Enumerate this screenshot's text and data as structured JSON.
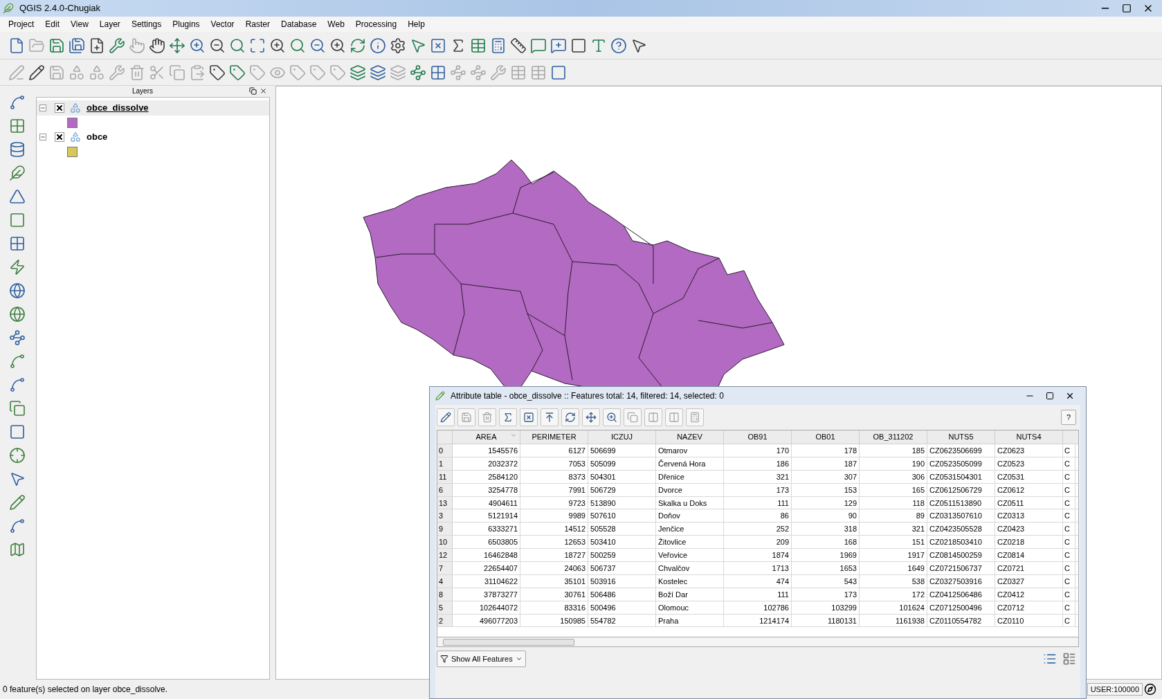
{
  "window": {
    "title": "QGIS 2.4.0-Chugiak"
  },
  "menu": [
    "Project",
    "Edit",
    "View",
    "Layer",
    "Settings",
    "Plugins",
    "Vector",
    "Raster",
    "Database",
    "Web",
    "Processing",
    "Help"
  ],
  "layers_panel": {
    "title": "Layers",
    "layers": [
      {
        "name": "obce_dissolve",
        "visible": true,
        "expanded": true,
        "selected": true,
        "color": "#b36ac2"
      },
      {
        "name": "obce",
        "visible": true,
        "expanded": true,
        "selected": false,
        "color": "#d8c85c"
      }
    ]
  },
  "attribute_table": {
    "title": "Attribute table - obce_dissolve :: Features total: 14, filtered: 14, selected: 0",
    "help": "?",
    "columns": [
      {
        "label": "AREA",
        "kind": "number",
        "sorted": true
      },
      {
        "label": "PERIMETER",
        "kind": "number",
        "sorted": false
      },
      {
        "label": "ICZUJ",
        "kind": "text",
        "sorted": false
      },
      {
        "label": "NAZEV",
        "kind": "text",
        "sorted": false
      },
      {
        "label": "OB91",
        "kind": "number",
        "sorted": false
      },
      {
        "label": "OB01",
        "kind": "number",
        "sorted": false
      },
      {
        "label": "OB_311202",
        "kind": "number",
        "sorted": false
      },
      {
        "label": "NUTS5",
        "kind": "text",
        "sorted": false
      },
      {
        "label": "NUTS4",
        "kind": "text",
        "sorted": false
      }
    ],
    "rows": [
      {
        "id": "0",
        "cells": [
          "1545576",
          "6127",
          "506699",
          "Otmarov",
          "170",
          "178",
          "185",
          "CZ0623506699",
          "CZ0623",
          "C"
        ]
      },
      {
        "id": "1",
        "cells": [
          "2032372",
          "7053",
          "505099",
          "Červená Hora",
          "186",
          "187",
          "190",
          "CZ0523505099",
          "CZ0523",
          "C"
        ]
      },
      {
        "id": "11",
        "cells": [
          "2584120",
          "8373",
          "504301",
          "Dřenice",
          "321",
          "307",
          "306",
          "CZ0531504301",
          "CZ0531",
          "C"
        ]
      },
      {
        "id": "6",
        "cells": [
          "3254778",
          "7991",
          "506729",
          "Dvorce",
          "173",
          "153",
          "165",
          "CZ0612506729",
          "CZ0612",
          "C"
        ]
      },
      {
        "id": "13",
        "cells": [
          "4904611",
          "9723",
          "513890",
          "Skalka u Doks",
          "111",
          "129",
          "118",
          "CZ0511513890",
          "CZ0511",
          "C"
        ]
      },
      {
        "id": "3",
        "cells": [
          "5121914",
          "9989",
          "507610",
          "Doňov",
          "86",
          "90",
          "89",
          "CZ0313507610",
          "CZ0313",
          "C"
        ]
      },
      {
        "id": "9",
        "cells": [
          "6333271",
          "14512",
          "505528",
          "Jenčice",
          "252",
          "318",
          "321",
          "CZ0423505528",
          "CZ0423",
          "C"
        ]
      },
      {
        "id": "10",
        "cells": [
          "6503805",
          "12653",
          "503410",
          "Žitovlice",
          "209",
          "168",
          "151",
          "CZ0218503410",
          "CZ0218",
          "C"
        ]
      },
      {
        "id": "12",
        "cells": [
          "16462848",
          "18727",
          "500259",
          "Veřovice",
          "1874",
          "1969",
          "1917",
          "CZ0814500259",
          "CZ0814",
          "C"
        ]
      },
      {
        "id": "7",
        "cells": [
          "22654407",
          "24063",
          "506737",
          "Chvalčov",
          "1713",
          "1653",
          "1649",
          "CZ0721506737",
          "CZ0721",
          "C"
        ]
      },
      {
        "id": "4",
        "cells": [
          "31104622",
          "35101",
          "503916",
          "Kostelec",
          "474",
          "543",
          "538",
          "CZ0327503916",
          "CZ0327",
          "C"
        ]
      },
      {
        "id": "8",
        "cells": [
          "37873277",
          "30761",
          "506486",
          "Boží Dar",
          "111",
          "173",
          "172",
          "CZ0412506486",
          "CZ0412",
          "C"
        ]
      },
      {
        "id": "5",
        "cells": [
          "102644072",
          "83316",
          "500496",
          "Olomouc",
          "102786",
          "103299",
          "101624",
          "CZ0712500496",
          "CZ0712",
          "C"
        ]
      },
      {
        "id": "2",
        "cells": [
          "496077203",
          "150985",
          "554782",
          "Praha",
          "1214174",
          "1180131",
          "1161938",
          "CZ0110554782",
          "CZ0110",
          "C"
        ]
      }
    ],
    "filter_button": "Show All Features"
  },
  "status_bar": {
    "message": "0 feature(s) selected on layer obce_dissolve.",
    "scale": "USER:100000"
  }
}
